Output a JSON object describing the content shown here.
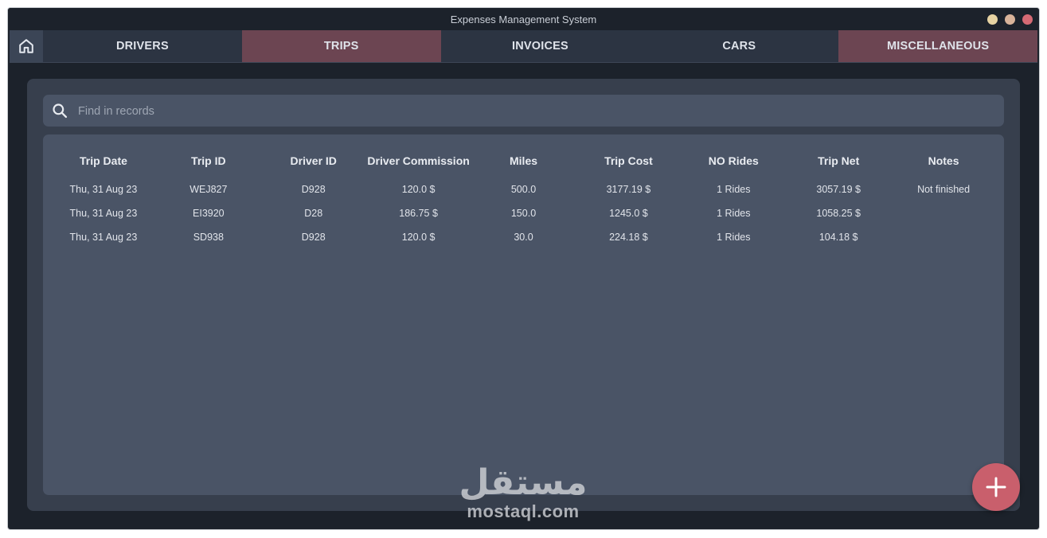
{
  "window": {
    "title": "Expenses Management System"
  },
  "nav": {
    "tabs": [
      {
        "label": "DRIVERS"
      },
      {
        "label": "TRIPS"
      },
      {
        "label": "INVOICES"
      },
      {
        "label": "CARS"
      },
      {
        "label": "MISCELLANEOUS"
      }
    ]
  },
  "search": {
    "placeholder": "Find in records",
    "value": ""
  },
  "table": {
    "columns": [
      "Trip Date",
      "Trip ID",
      "Driver ID",
      "Driver Commission",
      "Miles",
      "Trip Cost",
      "NO Rides",
      "Trip Net",
      "Notes"
    ],
    "rows": [
      [
        "Thu, 31 Aug 23",
        "WEJ827",
        "D928",
        "120.0 $",
        "500.0",
        "3177.19 $",
        "1 Rides",
        "3057.19 $",
        "Not finished"
      ],
      [
        "Thu, 31 Aug 23",
        "EI3920",
        "D28",
        "186.75 $",
        "150.0",
        "1245.0 $",
        "1 Rides",
        "1058.25 $",
        ""
      ],
      [
        "Thu, 31 Aug 23",
        "SD938",
        "D928",
        "120.0 $",
        "30.0",
        "224.18 $",
        "1 Rides",
        "104.18 $",
        ""
      ]
    ]
  },
  "watermark": {
    "arabic": "مستقل",
    "latin": "mostaql.com"
  },
  "icons": [
    "home-icon",
    "search-icon",
    "plus-icon"
  ],
  "colors": {
    "window_bg": "#1c222b",
    "panel_bg": "#373f4d",
    "card_bg": "#4a5466",
    "tab_accent": "#6c4552",
    "fab": "#c95f6c"
  }
}
